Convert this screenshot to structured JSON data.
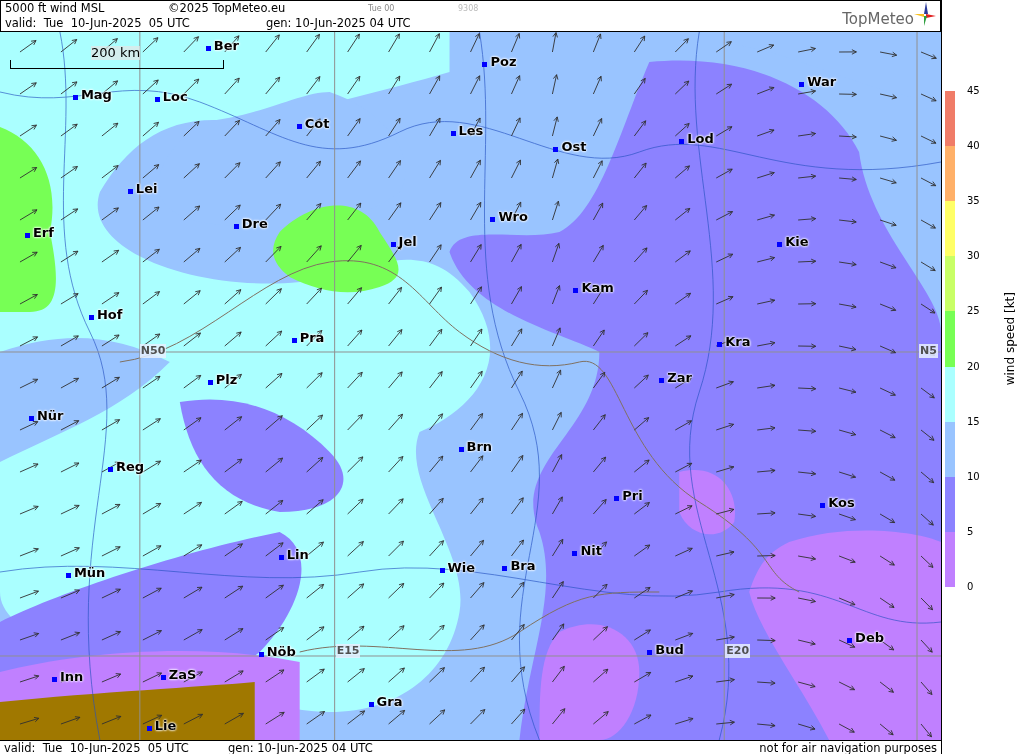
{
  "header": {
    "title": "5000 ft wind MSL",
    "copyright": "©2025 TopMeteo.eu",
    "run": "Tue 00",
    "code": "9308",
    "valid": "valid:  Tue  10-Jun-2025  05 UTC",
    "generated": "gen: 10-Jun-2025 04 UTC",
    "logo": "TopMeteo"
  },
  "map": {
    "scale": "200 km",
    "grid_labels": [
      "N50",
      "N5",
      "E15",
      "E20"
    ],
    "cities": [
      "Ber",
      "Mag",
      "Loc",
      "Poz",
      "War",
      "Cot",
      "Les",
      "Ost",
      "Lod",
      "Lei",
      "Dre",
      "Wro",
      "Erf",
      "Jel",
      "Kie",
      "Kam",
      "Hof",
      "Pra",
      "Kra",
      "Zar",
      "Plz",
      "Nür",
      "Brn",
      "Reg",
      "Pri",
      "Kos",
      "Lin",
      "Nit",
      "Wie",
      "Bra",
      "Mün",
      "Deb",
      "Nöb",
      "Bud",
      "Inn",
      "ZaS",
      "Gra",
      "Lie"
    ]
  },
  "legend": {
    "title": "wind speed [kt]",
    "ticks": [
      "45",
      "40",
      "35",
      "30",
      "25",
      "20",
      "15",
      "10",
      "5",
      "0"
    ],
    "bands": [
      {
        "color": "#f07c68"
      },
      {
        "color": "#ffb068"
      },
      {
        "color": "#ffff66"
      },
      {
        "color": "#c8ff66"
      },
      {
        "color": "#77ff55"
      },
      {
        "color": "#aaffff"
      },
      {
        "color": "#99c4ff"
      },
      {
        "color": "#8c82ff"
      },
      {
        "color": "#c080ff"
      }
    ]
  },
  "footer": {
    "valid": "valid:  Tue  10-Jun-2025  05 UTC",
    "generated": "gen: 10-Jun-2025 04 UTC",
    "notice": "not for air navigation purposes"
  }
}
